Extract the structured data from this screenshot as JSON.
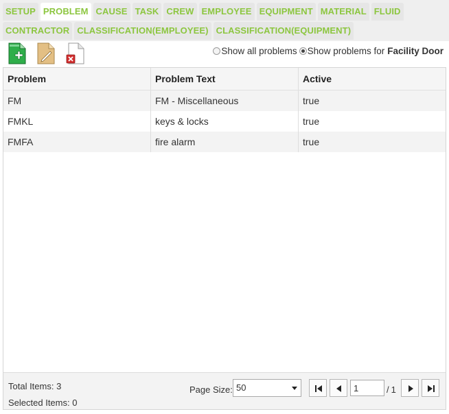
{
  "tabs": {
    "row1": [
      {
        "label": "SETUP",
        "active": false
      },
      {
        "label": "PROBLEM",
        "active": true
      },
      {
        "label": "CAUSE",
        "active": false
      },
      {
        "label": "TASK",
        "active": false
      },
      {
        "label": "CREW",
        "active": false
      },
      {
        "label": "EMPLOYEE",
        "active": false
      },
      {
        "label": "EQUIPMENT",
        "active": false
      },
      {
        "label": "MATERIAL",
        "active": false
      },
      {
        "label": "FLUID",
        "active": false
      }
    ],
    "row2": [
      {
        "label": "CONTRACTOR",
        "active": false
      },
      {
        "label": "CLASSIFICATION(EMPLOYEE)",
        "active": false
      },
      {
        "label": "CLASSIFICATION(EQUIPMENT)",
        "active": false
      }
    ]
  },
  "toolbar": {
    "icons": [
      "add-document-icon",
      "edit-document-icon",
      "delete-document-icon"
    ]
  },
  "filter": {
    "all_label": "Show all problems",
    "for_label": "Show problems for",
    "for_target": "Facility Door",
    "selected": "for"
  },
  "grid": {
    "columns": [
      "Problem",
      "Problem Text",
      "Active"
    ],
    "rows": [
      [
        "FM",
        "FM - Miscellaneous",
        "true"
      ],
      [
        "FMKL",
        "keys & locks",
        "true"
      ],
      [
        "FMFA",
        "fire alarm",
        "true"
      ]
    ]
  },
  "pager": {
    "total_label": "Total Items: 3",
    "selected_label": "Selected Items: 0",
    "page_size_label": "Page Size:",
    "page_size_value": "50",
    "current_page": "1",
    "total_pages": "1"
  },
  "colors": {
    "tab_text": "#8cc63f",
    "add_icon": "#1f9e3a",
    "delete_icon": "#c62828"
  }
}
